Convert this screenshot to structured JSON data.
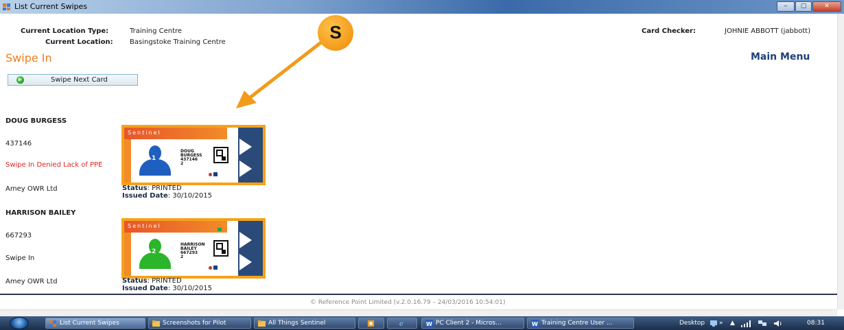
{
  "window": {
    "title": "List Current Swipes",
    "controls": [
      "‒",
      "▢",
      "✕"
    ]
  },
  "header": {
    "location_type_label": "Current Location Type:",
    "location_type_value": "Training Centre",
    "location_label": "Current Location:",
    "location_value": "Basingstoke Training Centre",
    "card_checker_label": "Card Checker:",
    "card_checker_value": "JOHNIE ABBOTT (jabbott)"
  },
  "page": {
    "title": "Swipe In",
    "main_menu": "Main Menu",
    "swipe_next_button": "Swipe Next Card"
  },
  "annotation": {
    "badge": "S"
  },
  "swipes": [
    {
      "name": "DOUG BURGESS",
      "id": "437146",
      "result": "Swipe In Denied Lack of PPE",
      "result_denied": true,
      "company": "Amey OWR Ltd",
      "status_label": "Status",
      "status_value": ": PRINTED",
      "issued_label": "Issued Date",
      "issued_value": ": 30/10/2015",
      "card": {
        "brand": "Sentinel",
        "badge_number": "1",
        "name_first": "DOUG",
        "name_last": "BURGESS",
        "sentinel_number": "437146",
        "issue_number": "2",
        "avatar_color": "#1f5fbf"
      }
    },
    {
      "name": "HARRISON BAILEY",
      "id": "667293",
      "result": "Swipe In",
      "result_denied": false,
      "company": "Amey OWR Ltd",
      "status_label": "Status",
      "status_value": ": PRINTED",
      "issued_label": "Issued Date",
      "issued_value": ": 30/10/2015",
      "card": {
        "brand": "Sentinel",
        "badge_number": "2",
        "name_first": "HARRISON",
        "name_last": "BAILEY",
        "sentinel_number": "667293",
        "issue_number": "2",
        "avatar_color": "#2bb52b"
      }
    }
  ],
  "footer": "© Reference Point Limited (v.2.0.16.79 – 24/03/2016 10:54:01)",
  "taskbar": {
    "items": [
      "List Current Swipes",
      "Screenshots for Pilot",
      "All Things Sentinel",
      "",
      "",
      "PC Client 2 - Micros...",
      "Training Centre User ..."
    ],
    "desktop_label": "Desktop",
    "clock": "08:31"
  },
  "colors": {
    "accent_orange": "#ef7d1a",
    "menu_blue": "#1f3f7a",
    "denied_red": "#e02020"
  }
}
